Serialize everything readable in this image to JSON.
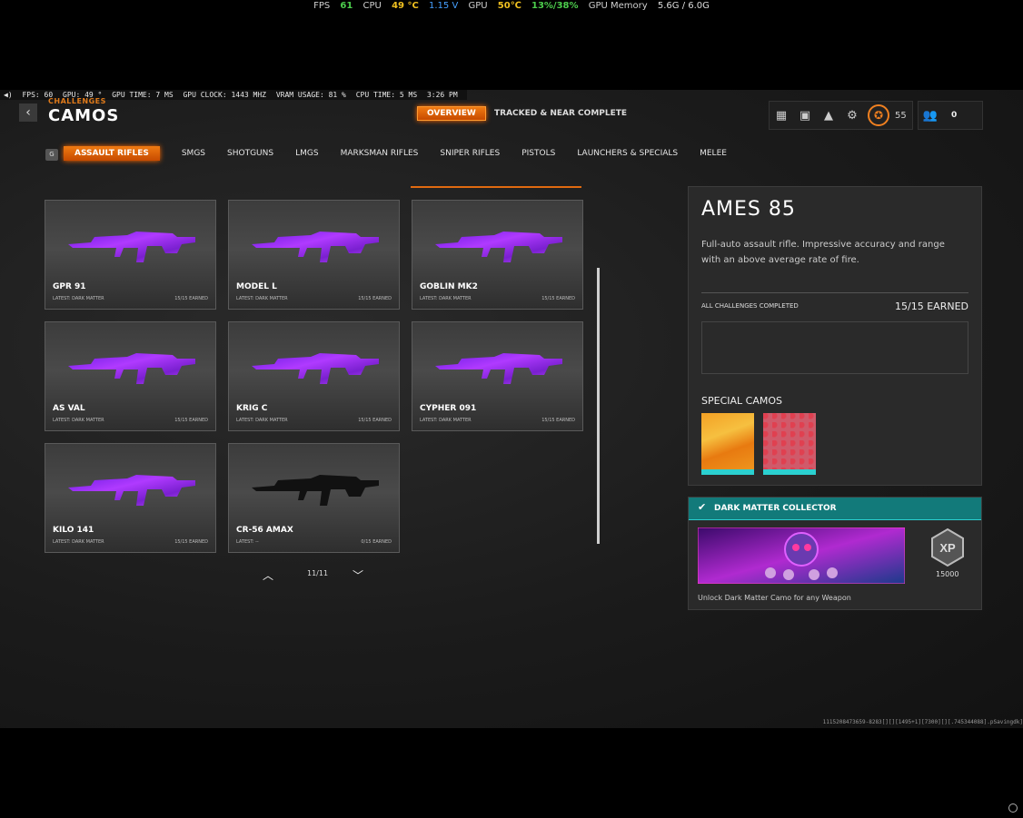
{
  "overlay": {
    "fps_label": "FPS",
    "fps": "61",
    "cpu_label": "CPU",
    "cpu_temp": "49 °C",
    "cpu_volt": "1.15 V",
    "gpu_label": "GPU",
    "gpu_temp": "50℃",
    "gpu_usage": "13%/38%",
    "gpu_mem_label": "GPU Memory",
    "gpu_mem": "5.6G / 6.0G"
  },
  "osd": {
    "fps": "FPS: 60",
    "gpu": "GPU: 49 °",
    "gpu_time": "GPU TIME: 7 MS",
    "gpu_clock": "GPU CLOCK: 1443 MHZ",
    "vram": "VRAM USAGE: 81 %",
    "cpu_time": "CPU TIME: 5 MS",
    "clock": "3:26 PM"
  },
  "header": {
    "back": "‹",
    "breadcrumb": "CHALLENGES",
    "title": "CAMOS",
    "tabs": {
      "overview": "OVERVIEW",
      "tracked": "TRACKED & NEAR COMPLETE"
    },
    "level": "55",
    "friends": "0"
  },
  "categories": {
    "key": "G",
    "items": [
      "ASSAULT RIFLES",
      "SMGS",
      "SHOTGUNS",
      "LMGS",
      "MARKSMAN RIFLES",
      "SNIPER RIFLES",
      "PISTOLS",
      "LAUNCHERS & SPECIALS",
      "MELEE"
    ]
  },
  "weapons": [
    {
      "name": "GPR 91",
      "latest": "LATEST: DARK MATTER",
      "earned": "15/15 EARNED",
      "camo": "dark-matter"
    },
    {
      "name": "MODEL L",
      "latest": "LATEST: DARK MATTER",
      "earned": "15/15 EARNED",
      "camo": "dark-matter"
    },
    {
      "name": "GOBLIN MK2",
      "latest": "LATEST: DARK MATTER",
      "earned": "15/15 EARNED",
      "camo": "dark-matter"
    },
    {
      "name": "AS VAL",
      "latest": "LATEST: DARK MATTER",
      "earned": "15/15 EARNED",
      "camo": "dark-matter"
    },
    {
      "name": "KRIG C",
      "latest": "LATEST: DARK MATTER",
      "earned": "15/15 EARNED",
      "camo": "dark-matter"
    },
    {
      "name": "CYPHER 091",
      "latest": "LATEST: DARK MATTER",
      "earned": "15/15 EARNED",
      "camo": "dark-matter"
    },
    {
      "name": "KILO 141",
      "latest": "LATEST: DARK MATTER",
      "earned": "15/15 EARNED",
      "camo": "dark-matter"
    },
    {
      "name": "CR-56 AMAX",
      "latest": "LATEST: --",
      "earned": "0/15 EARNED",
      "camo": "none"
    }
  ],
  "pagination": {
    "page": "11/11"
  },
  "detail": {
    "name": "AMES 85",
    "description": "Full-auto assault rifle.  Impressive accuracy and range with an above average rate of fire.",
    "challenges_label": "ALL CHALLENGES COMPLETED",
    "challenges_earned": "15/15 EARNED",
    "special_camos_label": "SPECIAL CAMOS"
  },
  "dark_matter": {
    "title": "DARK MATTER COLLECTOR",
    "xp": "15000",
    "unlock_text": "Unlock Dark Matter Camo for any Weapon"
  },
  "footer_code": "1115208473659-8283[][][1495+1][7300][][.745344088].pSavingdk]",
  "colors": {
    "accent": "#f07a12",
    "teal": "#127a7a",
    "dark_matter": "#8a2be2"
  }
}
